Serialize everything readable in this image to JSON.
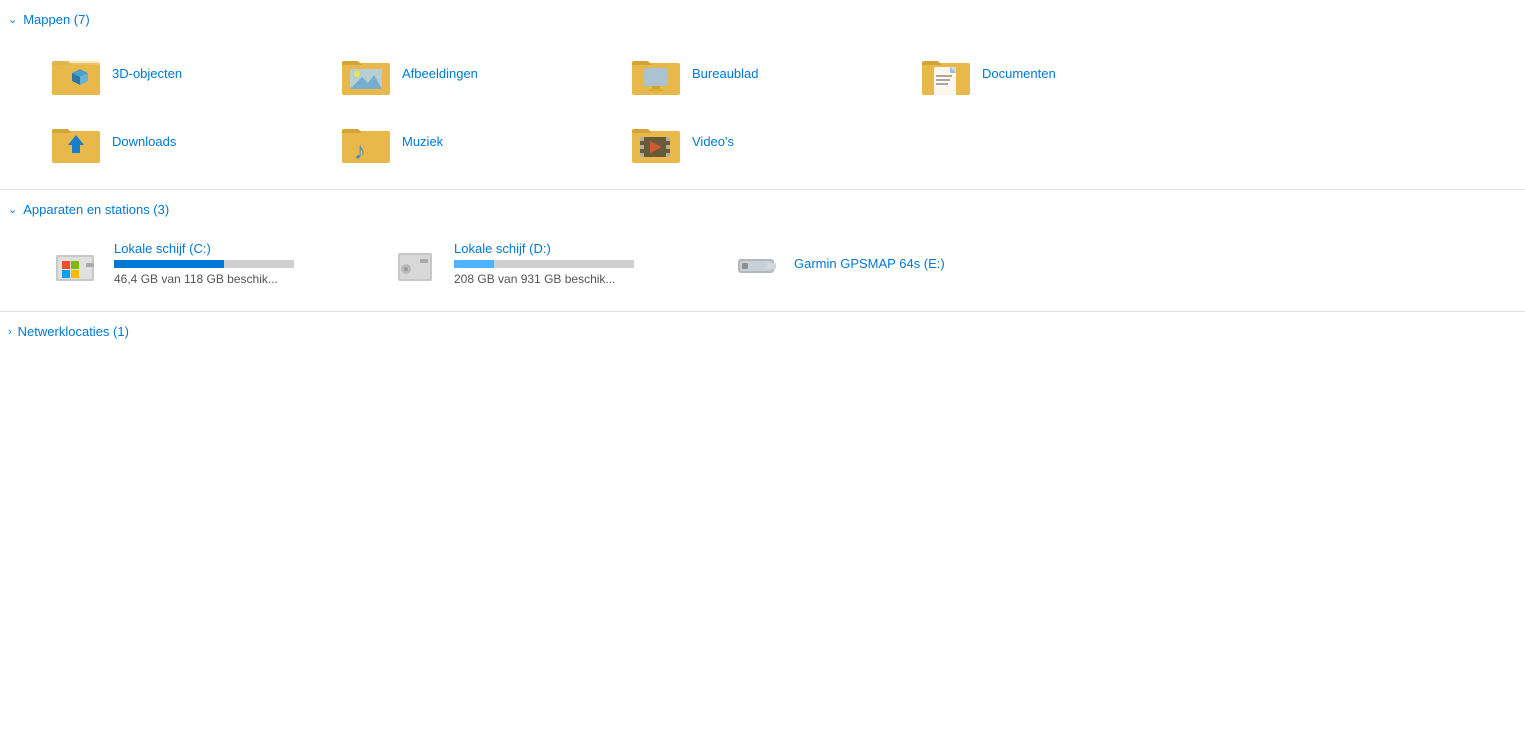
{
  "sections": {
    "mappen": {
      "label": "Mappen (7)",
      "expanded": true,
      "items": [
        {
          "id": "3d-objecten",
          "label": "3D-objecten",
          "type": "3d"
        },
        {
          "id": "afbeeldingen",
          "label": "Afbeeldingen",
          "type": "pictures"
        },
        {
          "id": "bureaublad",
          "label": "Bureaublad",
          "type": "desktop"
        },
        {
          "id": "documenten",
          "label": "Documenten",
          "type": "documents"
        },
        {
          "id": "downloads",
          "label": "Downloads",
          "type": "downloads"
        },
        {
          "id": "muziek",
          "label": "Muziek",
          "type": "music"
        },
        {
          "id": "videos",
          "label": "Video's",
          "type": "videos"
        }
      ]
    },
    "apparaten": {
      "label": "Apparaten en stations (3)",
      "expanded": true,
      "drives": [
        {
          "id": "c-drive",
          "label": "Lokale schijf (C:)",
          "size_text": "46,4 GB van 118 GB beschik...",
          "fill_pct": 61,
          "color": "blue",
          "type": "system"
        },
        {
          "id": "d-drive",
          "label": "Lokale schijf (D:)",
          "size_text": "208 GB van 931 GB beschik...",
          "fill_pct": 22,
          "color": "blue-light",
          "type": "hdd"
        },
        {
          "id": "e-drive",
          "label": "Garmin GPSMAP 64s (E:)",
          "size_text": "",
          "fill_pct": 0,
          "color": "",
          "type": "usb"
        }
      ]
    },
    "netwerklocaties": {
      "label": "Netwerklocaties (1)",
      "expanded": false
    }
  }
}
